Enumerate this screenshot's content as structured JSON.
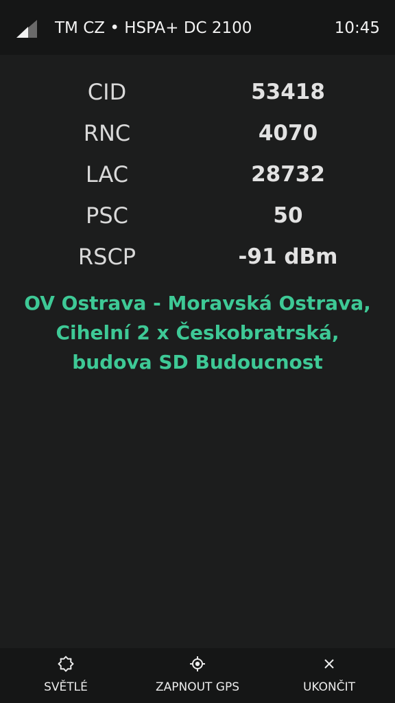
{
  "status_bar": {
    "carrier": "TM CZ • HSPA+ DC 2100",
    "time": "10:45",
    "signal_icon": "signal-strength-icon"
  },
  "cell_info": [
    {
      "label": "CID",
      "value": "53418"
    },
    {
      "label": "RNC",
      "value": "4070"
    },
    {
      "label": "LAC",
      "value": "28732"
    },
    {
      "label": "PSC",
      "value": "50"
    },
    {
      "label": "RSCP",
      "value": "-91 dBm"
    }
  ],
  "location": {
    "line1": "OV Ostrava - Moravská Ostrava,",
    "line2": "Cihelní 2 x Českobratrská,",
    "line3": "budova SD Budoucnost"
  },
  "actions": {
    "light": {
      "label": "SVĚTLÉ",
      "icon": "brightness-icon"
    },
    "gps": {
      "label": "ZAPNOUT GPS",
      "icon": "gps-icon"
    },
    "quit": {
      "label": "UKONČIT",
      "icon": "close-icon"
    }
  },
  "colors": {
    "background": "#1c1d1d",
    "bars": "#151616",
    "location_text": "#3ec996",
    "text": "#e6e6e6"
  }
}
